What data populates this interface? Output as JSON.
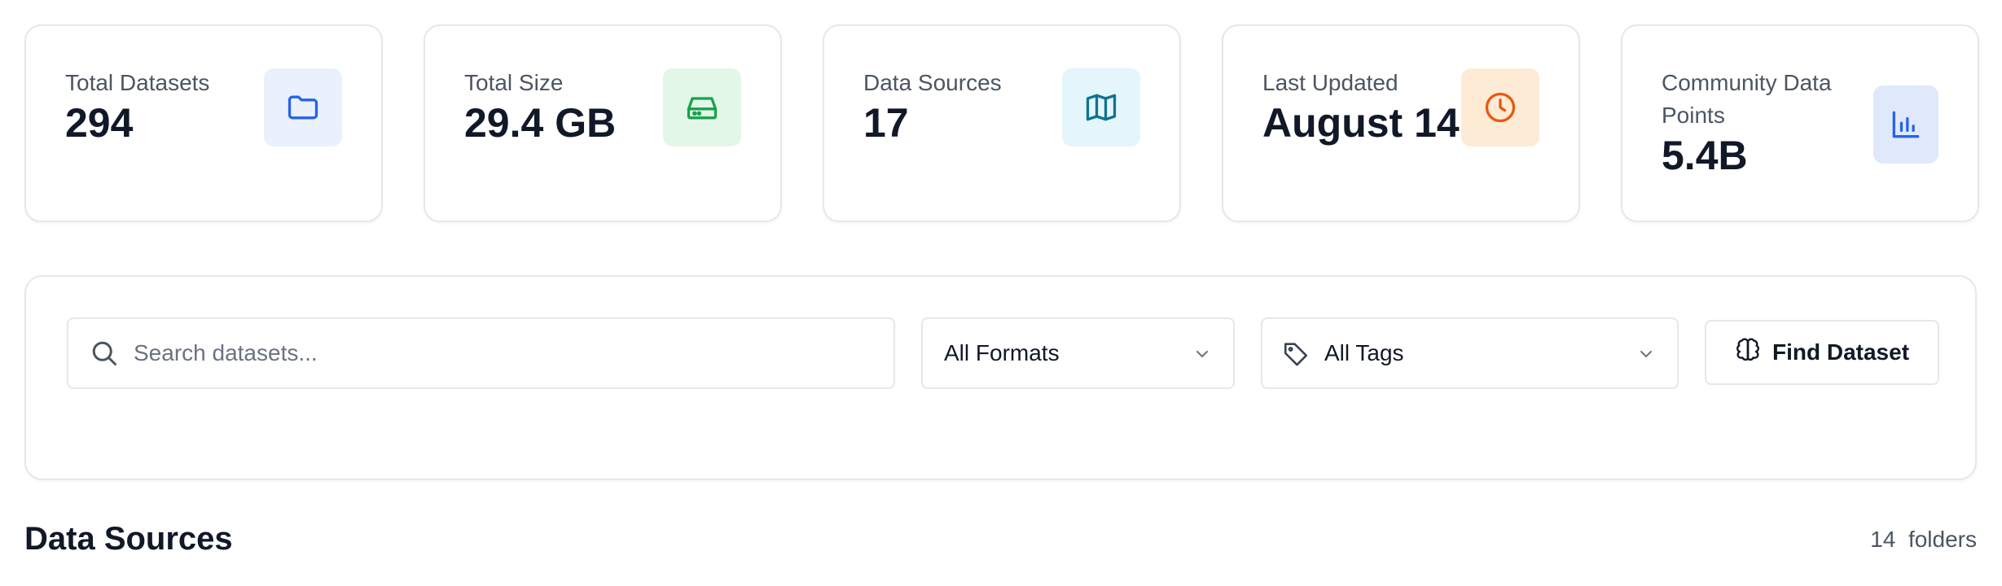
{
  "stats": [
    {
      "label": "Total Datasets",
      "value": "294",
      "icon": "folder-icon",
      "icon_color": "#2563eb",
      "icon_bg": "#eaf1fd"
    },
    {
      "label": "Total Size",
      "value": "29.4 GB",
      "icon": "hard-drive-icon",
      "icon_color": "#16a34a",
      "icon_bg": "#e3f7e8"
    },
    {
      "label": "Data Sources",
      "value": "17",
      "icon": "map-icon",
      "icon_color": "#0e7490",
      "icon_bg": "#e4f5fb"
    },
    {
      "label": "Last Updated",
      "value": "August 14",
      "icon": "clock-icon",
      "icon_color": "#ea580c",
      "icon_bg": "#fdebd6"
    },
    {
      "label": "Community Data Points",
      "value": "5.4B",
      "icon": "bar-chart-icon",
      "icon_color": "#2563eb",
      "icon_bg": "#e0e9fb"
    }
  ],
  "filters": {
    "search_placeholder": "Search datasets...",
    "search_value": "",
    "format_selected": "All Formats",
    "tags_selected": "All Tags",
    "find_button": "Find Dataset"
  },
  "section": {
    "title": "Data Sources",
    "count": "14",
    "count_unit": "folders"
  },
  "colors": {
    "border": "#e5e7eb",
    "text_primary": "#111827",
    "text_secondary": "#4b5563"
  }
}
